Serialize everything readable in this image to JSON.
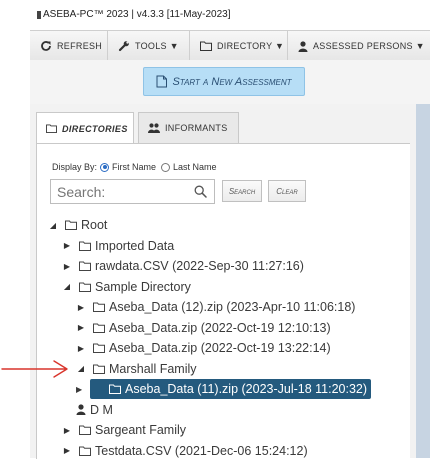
{
  "window": {
    "title": "ASEBA-PC™ 2023 | v4.3.3 [11-May-2023]"
  },
  "toolbar": {
    "refresh": "REFRESH",
    "tools": "TOOLS ▼",
    "directory": "DIRECTORY ▼",
    "assessed": "ASSESSED PERSONS ▼"
  },
  "start": {
    "label": "Start a New Assessment"
  },
  "tabs": {
    "directories": "DIRECTORIES",
    "informants": "INFORMANTS"
  },
  "display": {
    "label": "Display By:",
    "first": "First Name",
    "last": "Last Name",
    "selected": "First Name"
  },
  "search": {
    "placeholder": "Search:",
    "search_btn": "Search",
    "clear_btn": "Clear"
  },
  "tree": [
    {
      "label": "Root",
      "level": 0,
      "state": "expanded",
      "type": "folder"
    },
    {
      "label": "Imported Data",
      "level": 1,
      "state": "collapsed",
      "type": "folder"
    },
    {
      "label": "rawdata.CSV (2022-Sep-30 11:27:16)",
      "level": 1,
      "state": "collapsed",
      "type": "folder"
    },
    {
      "label": "Sample Directory",
      "level": 1,
      "state": "expanded",
      "type": "folder"
    },
    {
      "label": "Aseba_Data (12).zip (2023-Apr-10 11:06:18)",
      "level": 2,
      "state": "collapsed",
      "type": "folder"
    },
    {
      "label": "Aseba_Data.zip (2022-Oct-19 12:10:13)",
      "level": 2,
      "state": "collapsed",
      "type": "folder"
    },
    {
      "label": "Aseba_Data.zip (2022-Oct-19 13:22:14)",
      "level": 2,
      "state": "collapsed",
      "type": "folder"
    },
    {
      "label": "Marshall Family",
      "level": 2,
      "state": "expanded",
      "type": "folder"
    },
    {
      "label": "Aseba_Data (11).zip (2023-Jul-18 11:20:32)",
      "level": 3,
      "state": "collapsed",
      "type": "folder",
      "selected": true
    },
    {
      "label": "D M",
      "level": 2,
      "state": "leaf",
      "type": "person"
    },
    {
      "label": "Sargeant Family",
      "level": 1,
      "state": "collapsed",
      "type": "folder"
    },
    {
      "label": "Testdata.CSV (2021-Dec-06 15:24:12)",
      "level": 1,
      "state": "collapsed",
      "type": "folder"
    }
  ],
  "colors": {
    "accent": "#245a7e",
    "start_button": "#b7def6",
    "annotation_arrow": "#d9342b"
  }
}
